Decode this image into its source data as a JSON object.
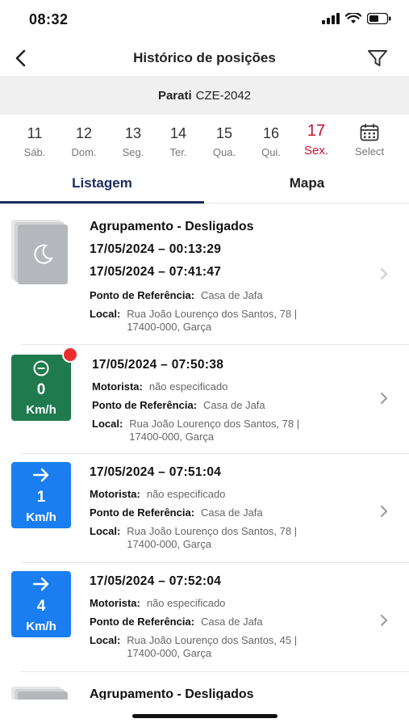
{
  "status_bar": {
    "time": "08:32"
  },
  "header": {
    "title": "Histórico de posições"
  },
  "vehicle": {
    "name": "Parati",
    "plate": "CZE-2042"
  },
  "days": [
    {
      "num": "11",
      "label": "Sáb."
    },
    {
      "num": "12",
      "label": "Dom."
    },
    {
      "num": "13",
      "label": "Seg."
    },
    {
      "num": "14",
      "label": "Ter."
    },
    {
      "num": "15",
      "label": "Qua."
    },
    {
      "num": "16",
      "label": "Qui."
    },
    {
      "num": "17",
      "label": "Sex."
    }
  ],
  "select_label": "Select",
  "tabs": [
    {
      "label": "Listagem"
    },
    {
      "label": "Mapa"
    }
  ],
  "items": [
    {
      "title": "Agrupamento - Desligados",
      "start": "17/05/2024  –  00:13:29",
      "end": "17/05/2024  –  07:41:47",
      "ref_label": "Ponto de Referência:",
      "ref_value": "Casa de Jafa",
      "local_label": "Local:",
      "local_line1": "Rua João Lourenço dos Santos, 78 |",
      "local_line2": "17400-000, Garça"
    },
    {
      "speed": "0",
      "unit": "Km/h",
      "datetime": "17/05/2024  –  07:50:38",
      "driver_label": "Motorista:",
      "driver_value": "não especificado",
      "ref_label": "Ponto de Referência:",
      "ref_value": "Casa de Jafa",
      "local_label": "Local:",
      "local_line1": "Rua João Lourenço dos Santos, 78 |",
      "local_line2": "17400-000, Garça"
    },
    {
      "speed": "1",
      "unit": "Km/h",
      "datetime": "17/05/2024  –  07:51:04",
      "driver_label": "Motorista:",
      "driver_value": "não especificado",
      "ref_label": "Ponto de Referência:",
      "ref_value": "Casa de Jafa",
      "local_label": "Local:",
      "local_line1": "Rua João Lourenço dos Santos, 78 |",
      "local_line2": "17400-000, Garça"
    },
    {
      "speed": "4",
      "unit": "Km/h",
      "datetime": "17/05/2024  –  07:52:04",
      "driver_label": "Motorista:",
      "driver_value": "não especificado",
      "ref_label": "Ponto de Referência:",
      "ref_value": "Casa de Jafa",
      "local_label": "Local:",
      "local_line1": "Rua João Lourenço dos Santos, 45 |",
      "local_line2": "17400-000, Garça"
    },
    {
      "title": "Agrupamento - Desligados"
    }
  ],
  "colors": {
    "accent": "#1d2b5e",
    "selected_day": "#c8102e",
    "stopped": "#1f7a4e",
    "moving": "#1a7ef0",
    "alert": "#ec2d2d"
  },
  "icons": [
    "back-arrow-icon",
    "filter-icon",
    "calendar-icon",
    "moon-icon",
    "minus-circle-icon",
    "arrow-right-icon",
    "chevron-right-icon"
  ]
}
